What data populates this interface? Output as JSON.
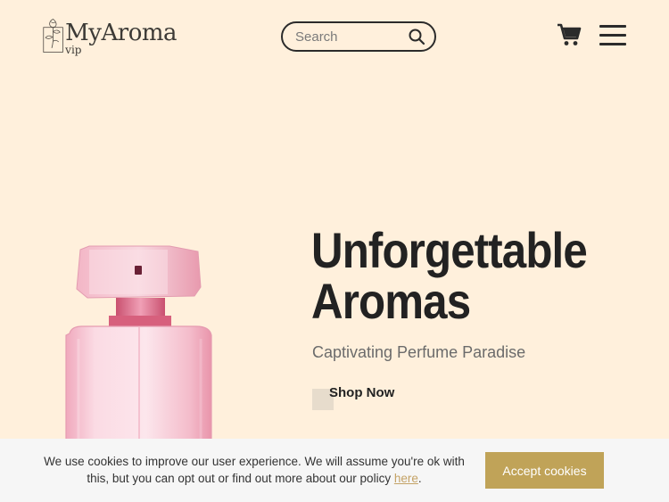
{
  "header": {
    "logo": {
      "name": "MyAroma",
      "sub": "vip"
    },
    "search": {
      "placeholder": "Search",
      "value": ""
    }
  },
  "hero": {
    "title_line1": "Unforgettable",
    "title_line2": "Aromas",
    "subtitle": "Captivating Perfume Paradise",
    "cta_label": "Shop Now"
  },
  "cookie": {
    "text_before": "We use cookies to improve our user experience. We will assume you're ok with this, but you can opt out or find out more about our policy ",
    "link_label": "here",
    "text_after": ".",
    "accept_label": "Accept cookies"
  },
  "colors": {
    "background": "#fff0dc",
    "accent": "#c0a358",
    "text": "#222222"
  },
  "icons": [
    "rose-logo-icon",
    "search-icon",
    "cart-icon",
    "hamburger-menu-icon"
  ]
}
